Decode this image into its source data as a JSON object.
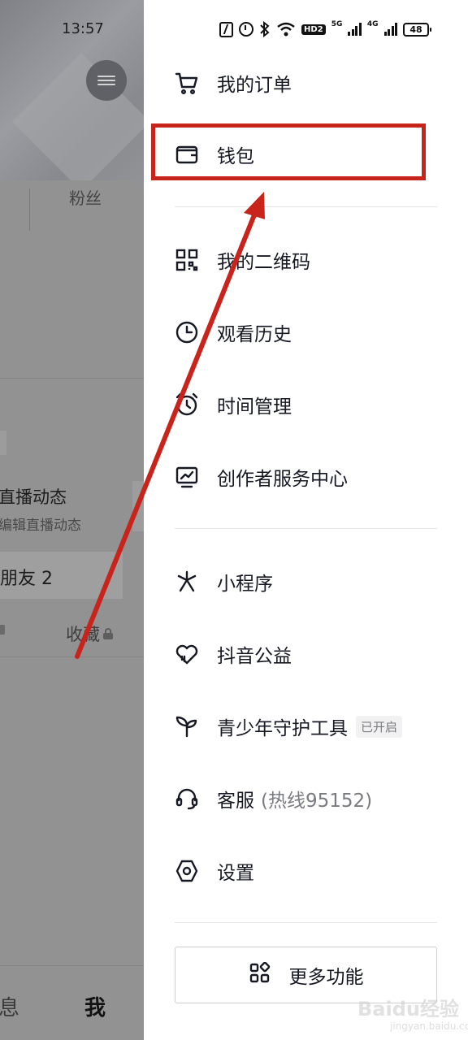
{
  "status_bar": {
    "time": "13:57",
    "battery": "48",
    "network_1": "5G",
    "network_2": "4G",
    "hd_label": "HD2"
  },
  "profile_bg": {
    "fans_label": "粉丝",
    "live_title": "直播动态",
    "live_sub": "编辑直播动态",
    "friends_label": "朋友 2",
    "collect_label": "收藏",
    "tab_messages": "息",
    "tab_me": "我"
  },
  "drawer": {
    "groups": [
      [
        {
          "label": "我的订单",
          "icon": "cart-icon"
        },
        {
          "label": "钱包",
          "icon": "wallet-icon"
        }
      ],
      [
        {
          "label": "我的二维码",
          "icon": "qrcode-icon"
        },
        {
          "label": "观看历史",
          "icon": "clock-icon"
        },
        {
          "label": "时间管理",
          "icon": "alarm-clock-icon"
        },
        {
          "label": "创作者服务中心",
          "icon": "chart-monitor-icon"
        }
      ],
      [
        {
          "label": "小程序",
          "icon": "mini-program-icon"
        },
        {
          "label": "抖音公益",
          "icon": "heart-hand-icon"
        },
        {
          "label": "青少年守护工具",
          "icon": "sprout-icon",
          "badge": "已开启"
        },
        {
          "label": "客服",
          "sub": "(热线95152)",
          "icon": "headset-icon"
        },
        {
          "label": "设置",
          "icon": "settings-hex-icon"
        }
      ]
    ],
    "more_button": "更多功能"
  },
  "watermark": {
    "text": "Baidu经验",
    "sub": "jingyan.baidu.com"
  },
  "colors": {
    "highlight": "#c8241c",
    "text": "#161823",
    "dim": "#8f8f8f"
  }
}
